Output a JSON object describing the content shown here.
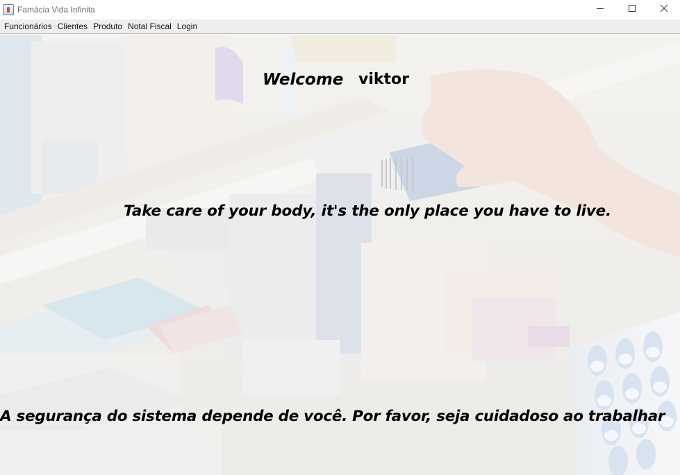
{
  "window": {
    "title": "Famácia Vida Infinita",
    "icon": "java-cup-icon",
    "controls": [
      "minimize-icon",
      "maximize-icon",
      "close-icon"
    ]
  },
  "menubar": {
    "items": [
      {
        "label": "Funcionários"
      },
      {
        "label": "Clientes"
      },
      {
        "label": "Produto"
      },
      {
        "label": "Notal Fiscal"
      },
      {
        "label": "Login"
      }
    ]
  },
  "main": {
    "welcome": "Welcome",
    "username": "viktor",
    "quote": "Take care of your body, it's the only place you have to live.",
    "warning": "A segurança do sistema depende de você. Por favor, seja cuidadoso ao trabalhar"
  },
  "colors": {
    "titlebar_bg": "#ffffff",
    "menubar_bg": "#eeeeee",
    "text": "#000000",
    "background_tint": "#f1f0ee"
  }
}
